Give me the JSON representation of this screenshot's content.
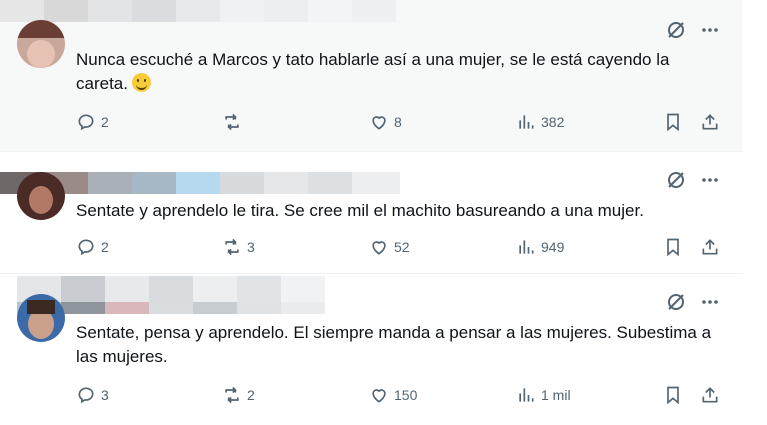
{
  "tweets": [
    {
      "text": "Nunca escuché a Marcos y tato hablarle así a una mujer, se le está cayendo la careta.",
      "emoji": "🫠",
      "replies": "2",
      "retweets": "",
      "likes": "8",
      "views": "382",
      "icons": {
        "reply": "reply-icon",
        "retweet": "retweet-icon",
        "like": "heart-icon",
        "views": "views-icon",
        "bookmark": "bookmark-icon",
        "share": "share-icon"
      }
    },
    {
      "text": "Sentate y aprendelo le tira. Se cree mil el machito basureando a una mujer.",
      "replies": "2",
      "retweets": "3",
      "likes": "52",
      "views": "949"
    },
    {
      "text": "Sentate, pensa y aprendelo. El siempre manda a pensar a las mujeres. Subestima a las mujeres.",
      "replies": "3",
      "retweets": "2",
      "likes": "150",
      "views": "1 mil"
    }
  ],
  "colors": {
    "icon_gray": "#536471",
    "text": "#0f1419",
    "divider": "#eff3f4",
    "highlight_bg": "#f7f9f9"
  }
}
